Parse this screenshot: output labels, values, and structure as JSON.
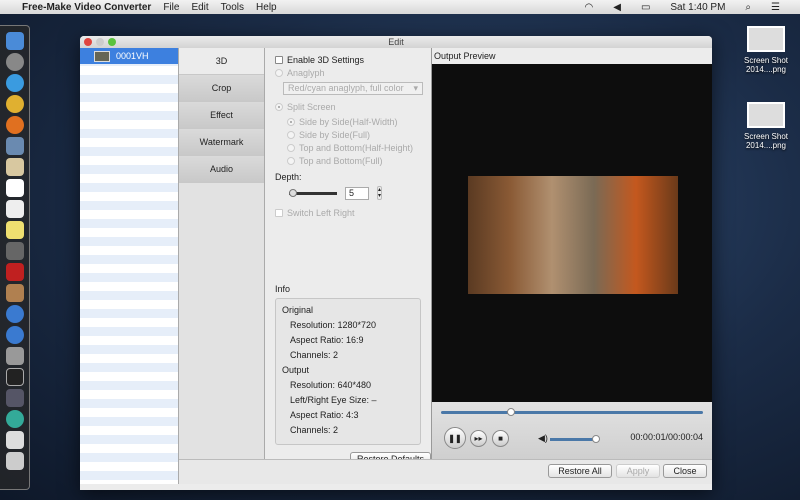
{
  "menubar": {
    "app": "Free-Make Video Converter",
    "items": [
      "File",
      "Edit",
      "Tools",
      "Help"
    ],
    "clock": "Sat 1:40 PM"
  },
  "window": {
    "title": "Edit"
  },
  "file_list": [
    {
      "name": "0001VH"
    }
  ],
  "tabs": [
    "3D",
    "Crop",
    "Effect",
    "Watermark",
    "Audio"
  ],
  "settings": {
    "enable_3d": "Enable 3D Settings",
    "anaglyph": "Anaglyph",
    "anaglyph_option": "Red/cyan anaglyph, full color",
    "split_screen": "Split Screen",
    "split_options": [
      "Side by Side(Half-Width)",
      "Side by Side(Full)",
      "Top and Bottom(Half-Height)",
      "Top and Bottom(Full)"
    ],
    "depth_label": "Depth:",
    "depth_value": "5",
    "switch_lr": "Switch Left Right"
  },
  "info": {
    "title": "Info",
    "original": "Original",
    "orig_resolution": "Resolution: 1280*720",
    "orig_aspect": "Aspect Ratio: 16:9",
    "orig_channels": "Channels: 2",
    "output": "Output",
    "out_resolution": "Resolution: 640*480",
    "out_eye": "Left/Right Eye Size: –",
    "out_aspect": "Aspect Ratio: 4:3",
    "out_channels": "Channels: 2",
    "restore_defaults": "Restore Defaults"
  },
  "preview": {
    "title": "Output Preview",
    "time": "00:00:01/00:00:04",
    "seek_fraction": 0.25,
    "volume_fraction": 0.95
  },
  "buttons": {
    "restore_all": "Restore All",
    "apply": "Apply",
    "close": "Close"
  },
  "desktop": [
    {
      "label": "Screen Shot 2014....png"
    },
    {
      "label": "Screen Shot 2014....png"
    }
  ]
}
